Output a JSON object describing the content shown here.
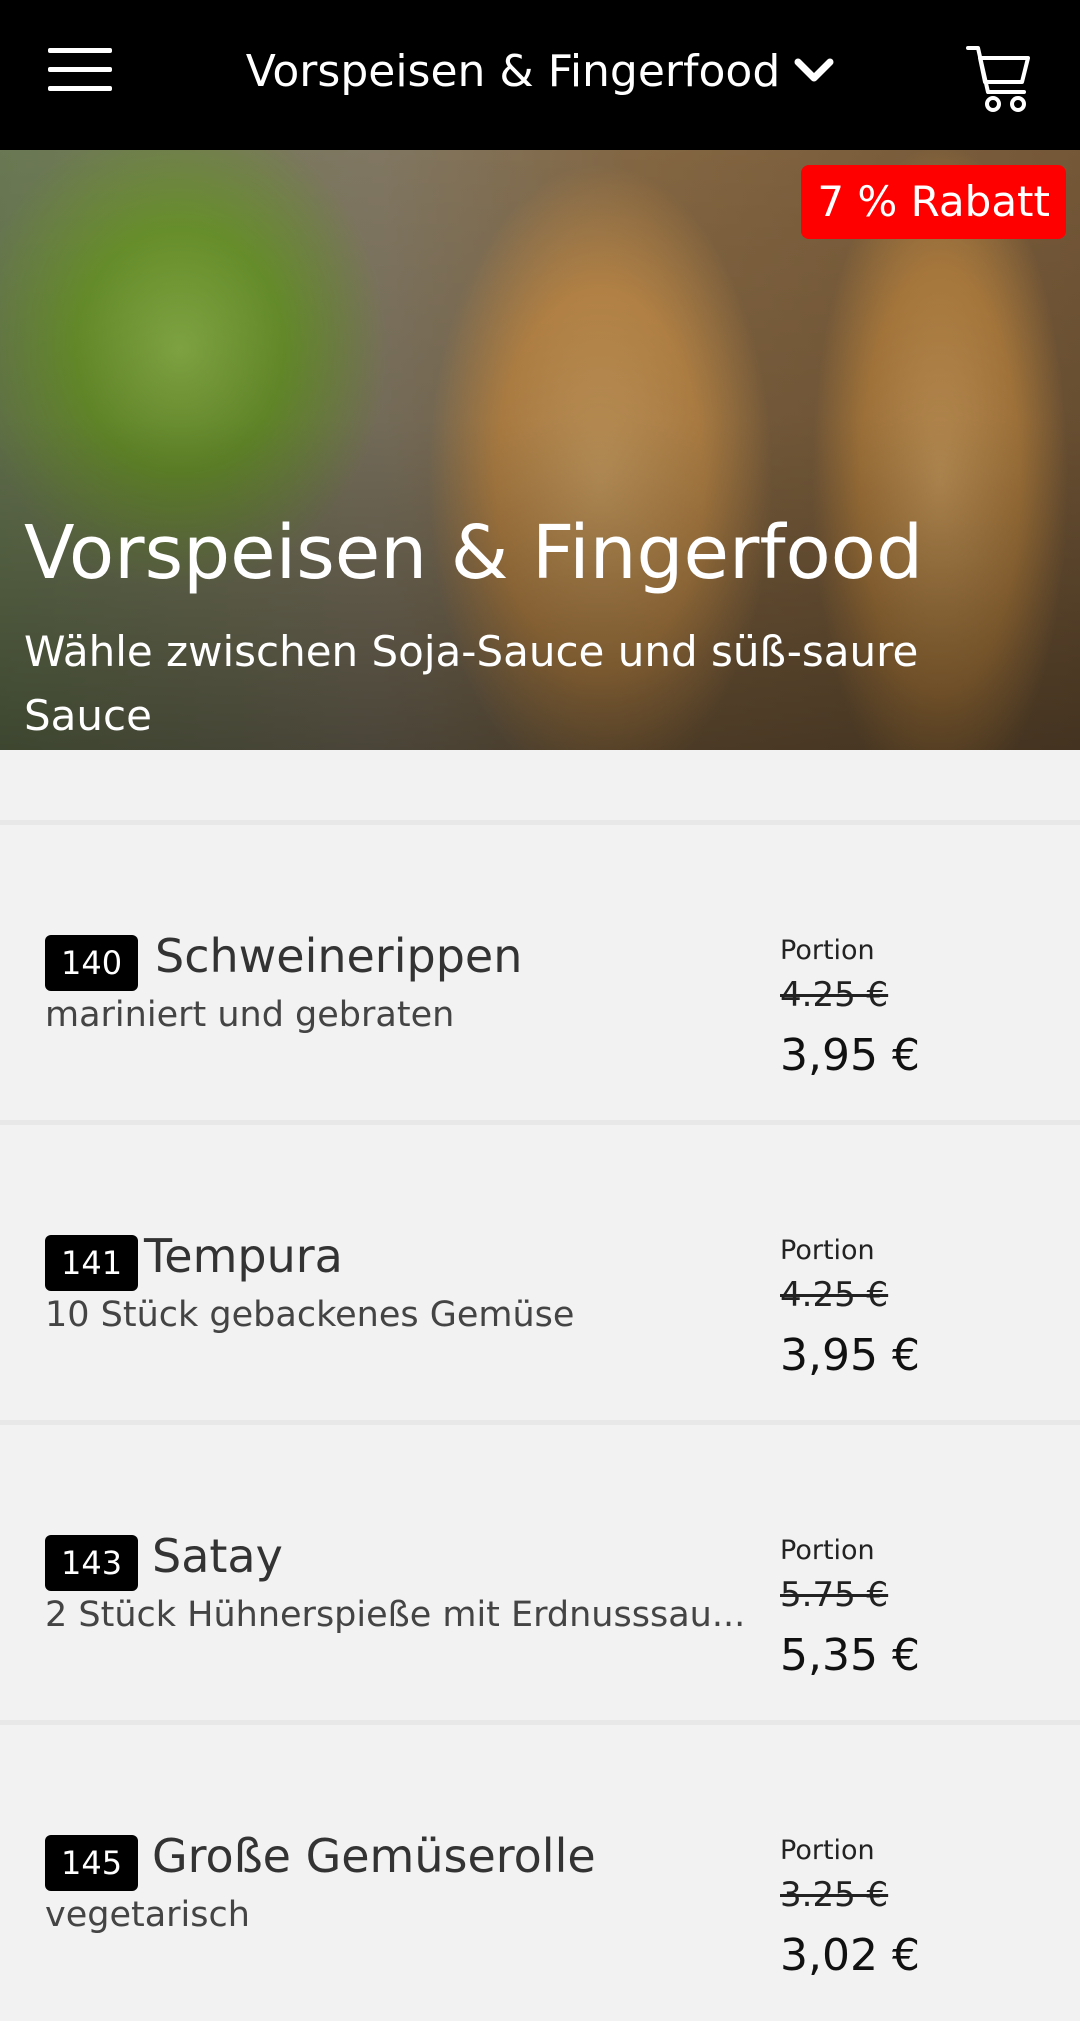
{
  "header": {
    "category_label": "Vorspeisen & Fingerfood"
  },
  "hero": {
    "discount_badge": "7 % Rabatt",
    "title": "Vorspeisen & Fingerfood",
    "subtitle": "Wähle zwischen Soja-Sauce und süß-saure Sauce"
  },
  "items": [
    {
      "number": "140",
      "name": "Schweinerippen",
      "description": "mariniert und gebraten",
      "portion_label": "Portion",
      "old_price": "4.25 €",
      "new_price": "3,95 €"
    },
    {
      "number": "141",
      "name": "Tempura",
      "description": "10 Stück gebackenes Gemüse",
      "portion_label": "Portion",
      "old_price": "4.25 €",
      "new_price": "3,95 €"
    },
    {
      "number": "143",
      "name": "Satay",
      "description": "2 Stück Hühnerspieße mit Erdnusssau...",
      "portion_label": "Portion",
      "old_price": "5.75 €",
      "new_price": "5,35 €"
    },
    {
      "number": "145",
      "name": "Große Gemüserolle",
      "description": "vegetarisch",
      "portion_label": "Portion",
      "old_price": "3.25 €",
      "new_price": "3,02 €"
    }
  ],
  "icons": {
    "menu": "hamburger-menu-icon",
    "dropdown": "chevron-down-icon",
    "cart": "shopping-cart-icon"
  },
  "colors": {
    "header_bg": "#000000",
    "badge_bg": "#ff0000",
    "page_bg": "#f2f2f2"
  }
}
